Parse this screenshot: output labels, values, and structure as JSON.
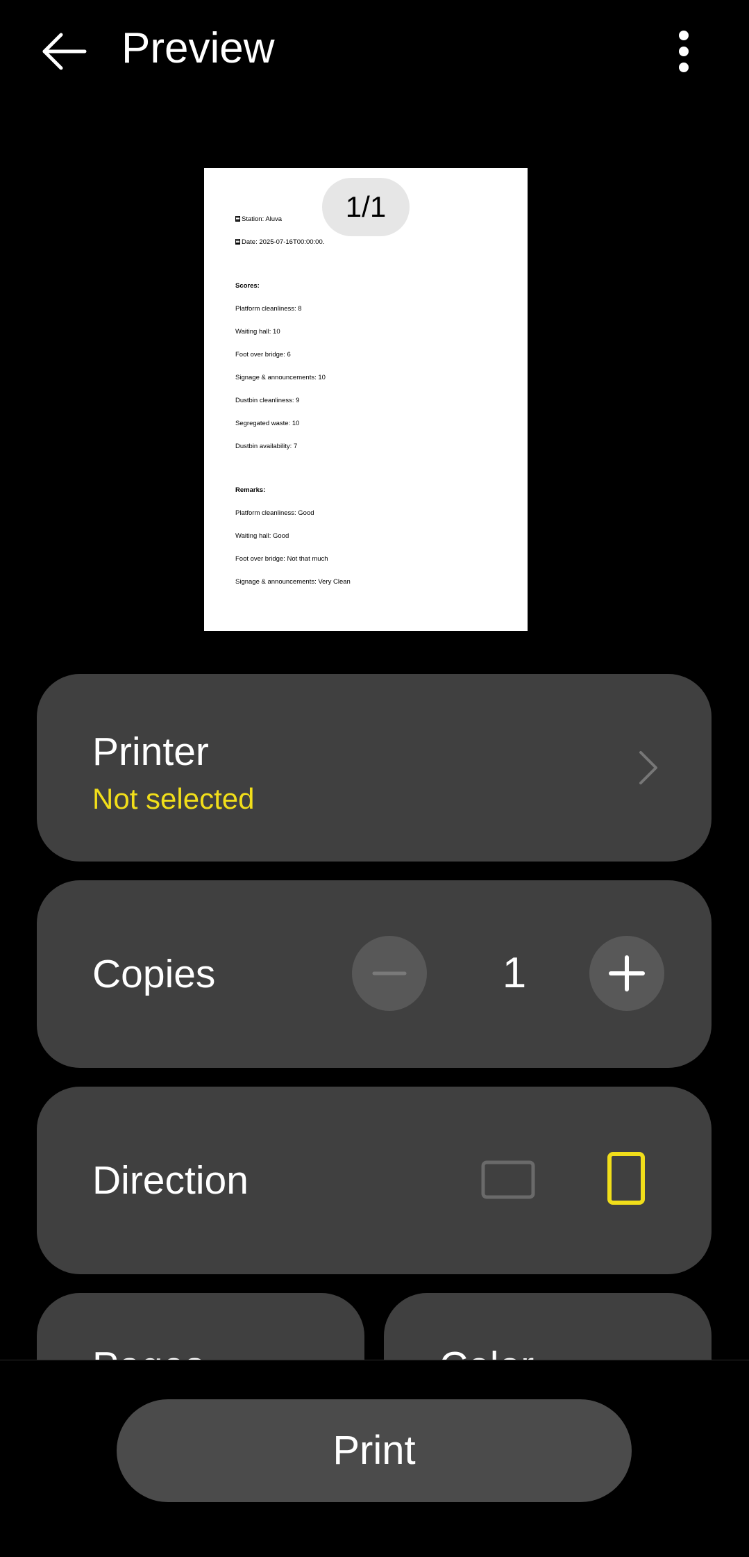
{
  "header": {
    "title": "Preview"
  },
  "preview": {
    "page_counter": "1/1",
    "document_lines": {
      "station": "Station: Aluva",
      "date": "Date: 2025-07-16T00:00:00.",
      "scores_heading": "Scores:",
      "scores": [
        "Platform cleanliness: 8",
        "Waiting hall: 10",
        "Foot over bridge: 6",
        "Signage & announcements: 10",
        "Dustbin cleanliness: 9",
        "Segregated waste: 10",
        "Dustbin availability: 7"
      ],
      "remarks_heading": "Remarks:",
      "remarks": [
        "Platform cleanliness: Good",
        "Waiting hall: Good",
        "Foot over bridge: Not that much",
        "Signage & announcements: Very Clean"
      ]
    }
  },
  "printer": {
    "label": "Printer",
    "status": "Not selected",
    "status_color": "#f1de1a"
  },
  "copies": {
    "label": "Copies",
    "value": "1"
  },
  "direction": {
    "label": "Direction",
    "selected": "portrait",
    "accent_color": "#f1de1a"
  },
  "pages": {
    "label": "Pages"
  },
  "color": {
    "label": "Color"
  },
  "print_button": {
    "label": "Print"
  }
}
